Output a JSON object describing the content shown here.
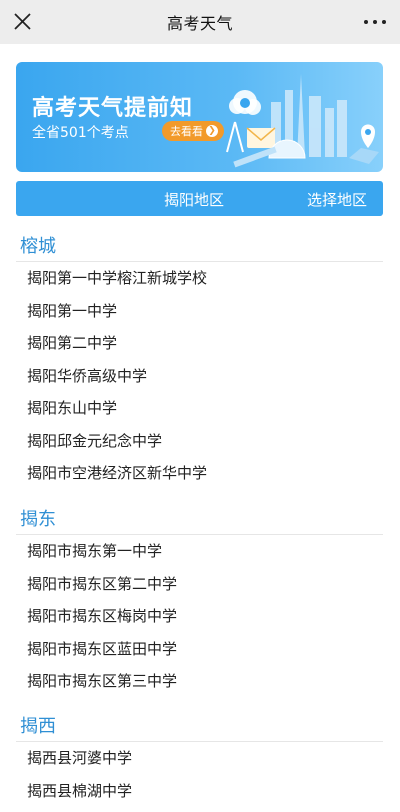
{
  "navbar": {
    "title": "高考天气",
    "close_icon": "close-icon",
    "more_icon": "more-icon"
  },
  "banner": {
    "title": "高考天气提前知",
    "subtitle": "全省501个考点",
    "button_label": "去看看",
    "colors": {
      "start": "#3aa6ef",
      "end": "#88d0fb",
      "button": "#f29a2a"
    }
  },
  "region": {
    "current": "揭阳地区",
    "select_label": "选择地区",
    "color": "#3aa6ef"
  },
  "sections": [
    {
      "title": "榕城",
      "schools": [
        "揭阳第一中学榕江新城学校",
        "揭阳第一中学",
        "揭阳第二中学",
        "揭阳华侨高级中学",
        "揭阳东山中学",
        "揭阳邱金元纪念中学",
        "揭阳市空港经济区新华中学"
      ]
    },
    {
      "title": "揭东",
      "schools": [
        "揭阳市揭东第一中学",
        "揭阳市揭东区第二中学",
        "揭阳市揭东区梅岗中学",
        "揭阳市揭东区蓝田中学",
        "揭阳市揭东区第三中学"
      ]
    },
    {
      "title": "揭西",
      "schools": [
        "揭西县河婆中学",
        "揭西县棉湖中学"
      ]
    }
  ]
}
